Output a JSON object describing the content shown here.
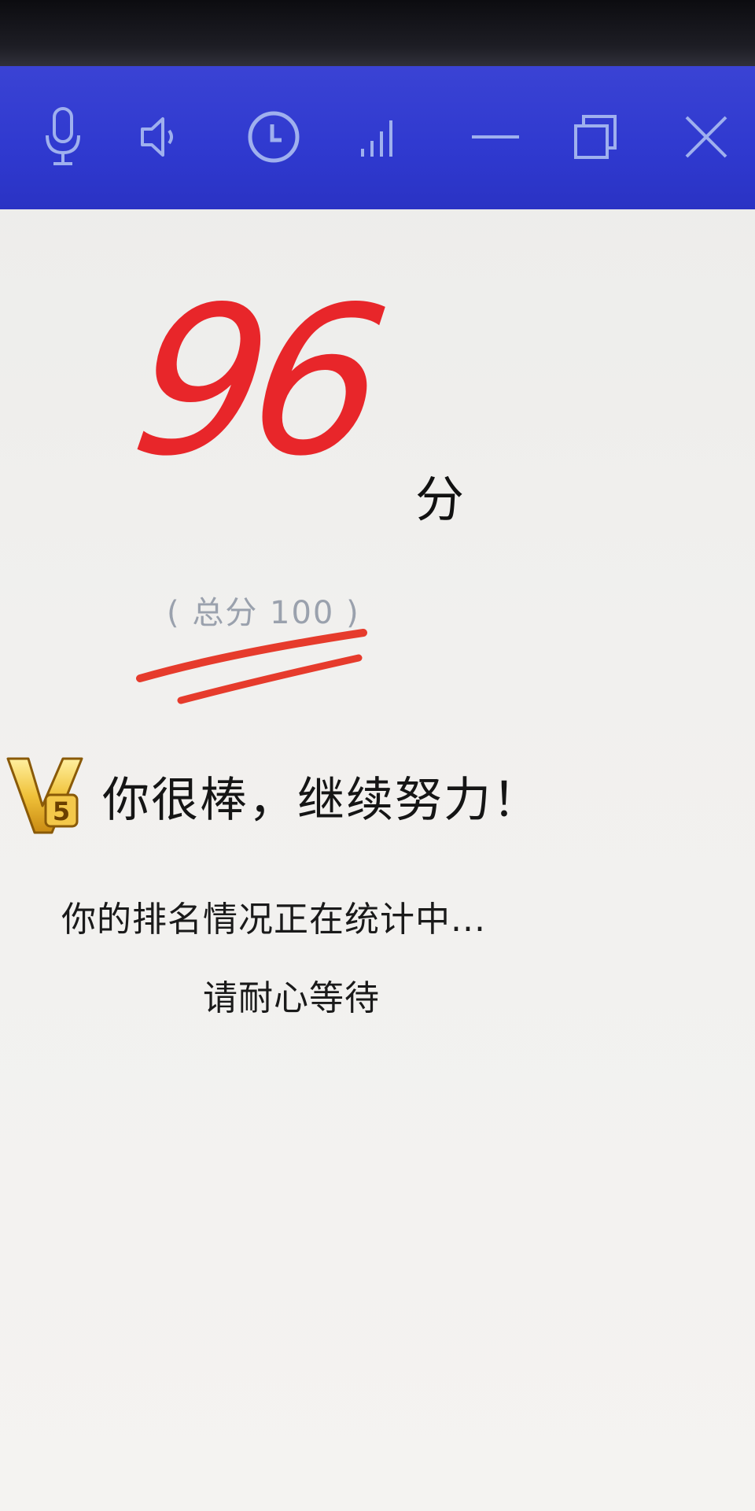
{
  "titlebar": {
    "icons": [
      "microphone-icon",
      "speaker-icon",
      "clock-icon",
      "signal-icon",
      "minimize-icon",
      "restore-icon",
      "close-icon"
    ],
    "color": "#2f39cf"
  },
  "score": {
    "value": "96",
    "unit": "分",
    "total": "( 总分 100 )",
    "color": "#e8262a"
  },
  "praise": {
    "badge_icon": "vip-badge-icon",
    "text": "你很棒，继续努力！"
  },
  "status": {
    "ranking": "你的排名情况正在统计中...",
    "wait": "请耐心等待"
  }
}
